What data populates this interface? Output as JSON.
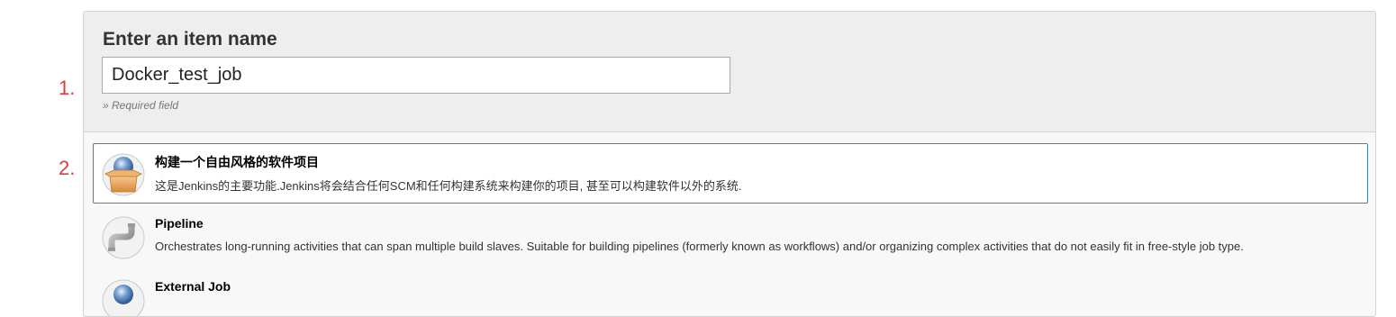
{
  "annotations": [
    "1.",
    "2."
  ],
  "form": {
    "title": "Enter an item name",
    "item_name_value": "Docker_test_job",
    "required_hint": "» Required field"
  },
  "job_types": [
    {
      "label": "构建一个自由风格的软件项目",
      "description": "这是Jenkins的主要功能.Jenkins将会结合任何SCM和任何构建系统来构建你的项目, 甚至可以构建软件以外的系统.",
      "icon": "freestyle-project-icon",
      "selected": true
    },
    {
      "label": "Pipeline",
      "description": "Orchestrates long-running activities that can span multiple build slaves. Suitable for building pipelines (formerly known as workflows) and/or organizing complex activities that do not easily fit in free-style job type.",
      "icon": "pipeline-icon",
      "selected": false
    },
    {
      "label": "External Job",
      "description": "",
      "icon": "external-job-icon",
      "selected": false
    }
  ],
  "colors": {
    "annotation": "#e53935",
    "selected_border": "#4a80b8",
    "header_bg": "#eeeeee"
  }
}
